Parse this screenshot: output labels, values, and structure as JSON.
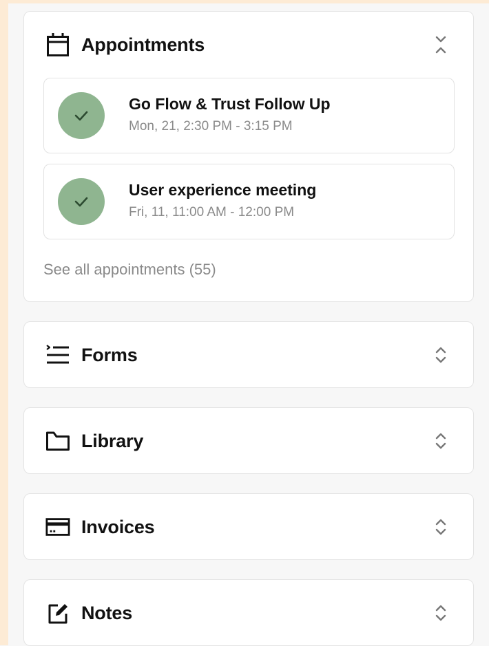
{
  "appointments": {
    "title": "Appointments",
    "items": [
      {
        "title": "Go Flow & Trust Follow Up",
        "time": "Mon, 21, 2:30 PM - 3:15 PM",
        "status": "completed"
      },
      {
        "title": "User experience meeting",
        "time": "Fri, 11, 11:00 AM - 12:00 PM",
        "status": "completed"
      }
    ],
    "see_all": "See all appointments (55)"
  },
  "sections": [
    {
      "title": "Forms",
      "icon": "list-icon"
    },
    {
      "title": "Library",
      "icon": "folder-icon"
    },
    {
      "title": "Invoices",
      "icon": "credit-card-icon"
    },
    {
      "title": "Notes",
      "icon": "edit-note-icon"
    }
  ],
  "colors": {
    "accent_green": "#8fb590",
    "side_strip": "#fdebd5",
    "muted_text": "#8a8a8a"
  }
}
